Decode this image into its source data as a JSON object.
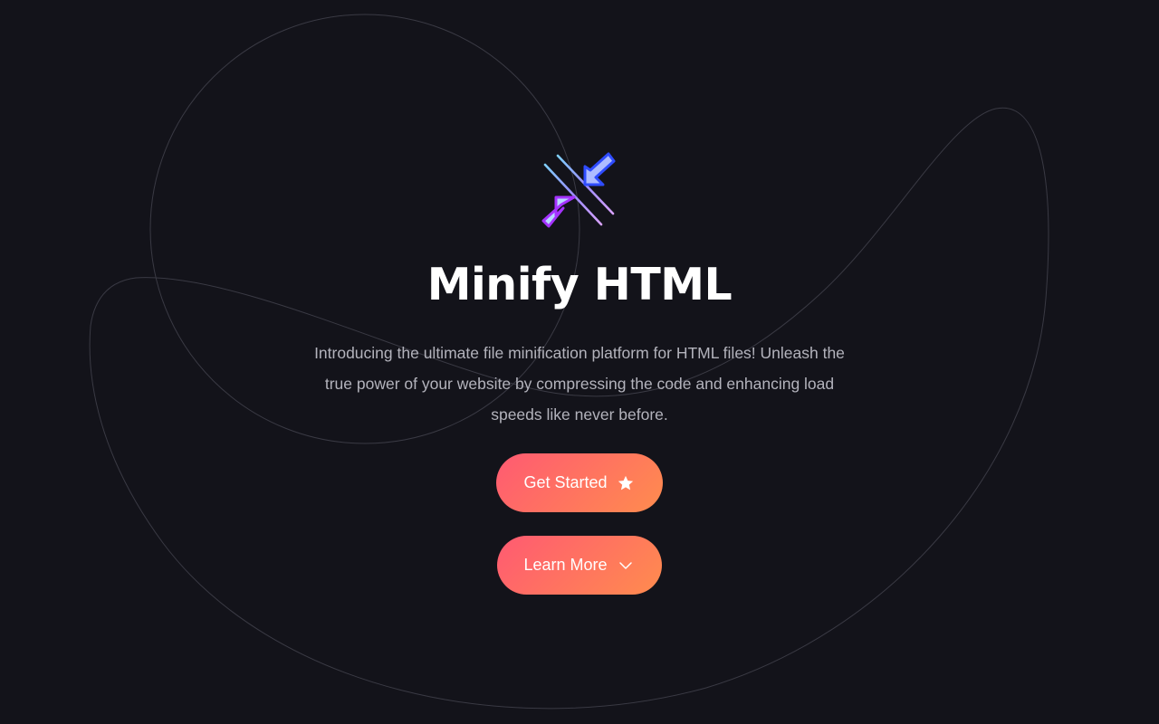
{
  "hero": {
    "title": "Minify HTML",
    "description": "Introducing the ultimate file minification platform for HTML files! Unleash the true power of your website by compressing the code and enhancing load speeds like never before.",
    "logo_icon": "compress-arrows-icon"
  },
  "buttons": {
    "get_started_label": "Get Started",
    "get_started_icon": "star-icon",
    "learn_more_label": "Learn More",
    "learn_more_icon": "chevron-down-icon"
  },
  "colors": {
    "background": "#13131a",
    "title": "#ffffff",
    "description": "#b3b3bc",
    "button_gradient_start": "#ff5a72",
    "button_gradient_end": "#ff8c4e",
    "logo_blue": "#2f5cff",
    "logo_purple": "#a533ff",
    "logo_light": "#9fd2ff"
  }
}
